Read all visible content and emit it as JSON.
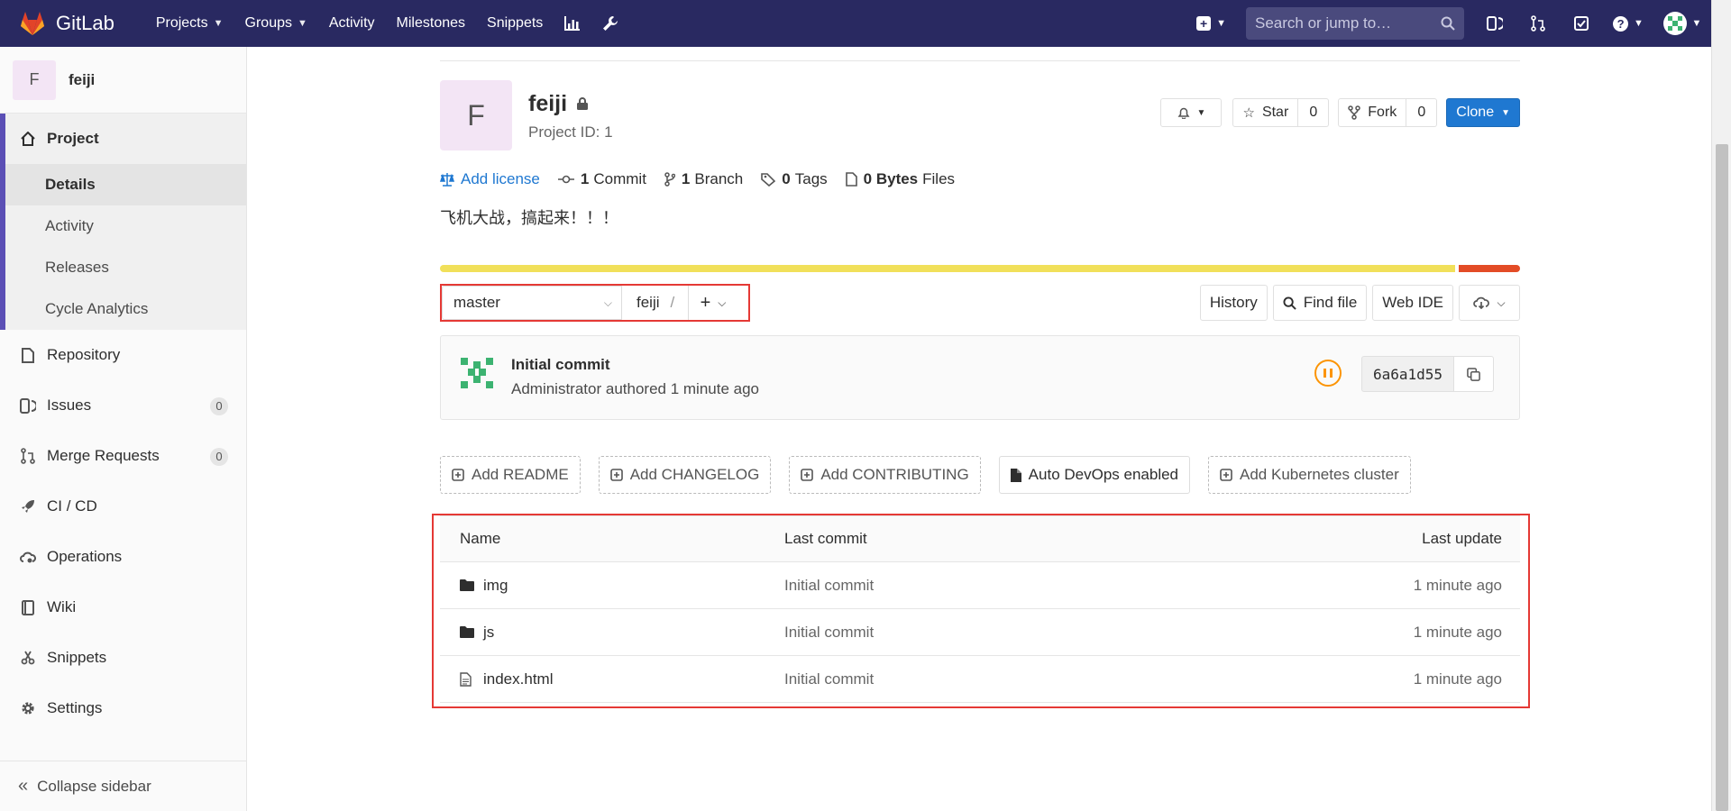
{
  "navbar": {
    "brand": "GitLab",
    "links": [
      {
        "label": "Projects",
        "caret": true
      },
      {
        "label": "Groups",
        "caret": true
      },
      {
        "label": "Activity",
        "caret": false
      },
      {
        "label": "Milestones",
        "caret": false
      },
      {
        "label": "Snippets",
        "caret": false
      }
    ],
    "icons": [
      "chart-icon",
      "wrench-icon"
    ],
    "search_placeholder": "Search or jump to…",
    "right_icons": [
      "issues-icon",
      "merge-request-icon",
      "todo-icon",
      "help-icon",
      "user-avatar"
    ],
    "bg_color": "#292961"
  },
  "sidebar": {
    "project_initial": "F",
    "project_name": "feiji",
    "section": {
      "label": "Project",
      "icon": "home-icon",
      "items": [
        "Details",
        "Activity",
        "Releases",
        "Cycle Analytics"
      ],
      "active": "Details"
    },
    "items": [
      {
        "label": "Repository",
        "icon": "doc-icon",
        "badge": null
      },
      {
        "label": "Issues",
        "icon": "issues-icon",
        "badge": "0"
      },
      {
        "label": "Merge Requests",
        "icon": "merge-request-icon",
        "badge": "0"
      },
      {
        "label": "CI / CD",
        "icon": "rocket-icon",
        "badge": null
      },
      {
        "label": "Operations",
        "icon": "cloud-gear-icon",
        "badge": null
      },
      {
        "label": "Wiki",
        "icon": "book-icon",
        "badge": null
      },
      {
        "label": "Snippets",
        "icon": "scissors-icon",
        "badge": null
      },
      {
        "label": "Settings",
        "icon": "gear-icon",
        "badge": null
      }
    ],
    "collapse_label": "Collapse sidebar"
  },
  "project": {
    "initial": "F",
    "name": "feiji",
    "id_label": "Project ID: 1",
    "star_label": "Star",
    "star_count": "0",
    "fork_label": "Fork",
    "fork_count": "0",
    "clone_label": "Clone",
    "stats": {
      "license": "Add license",
      "commits_num": "1",
      "commits_label": "Commit",
      "branches_num": "1",
      "branches_label": "Branch",
      "tags_num": "0",
      "tags_label": "Tags",
      "size_num": "0 Bytes",
      "size_label": "Files"
    },
    "description": "飞机大战，搞起来！！！",
    "languages": [
      {
        "color": "#f1e05a",
        "percent": 94
      },
      {
        "color": "#e34c26",
        "percent": 6
      }
    ]
  },
  "tree": {
    "branch": "master",
    "path": "feiji",
    "path_sep": "/",
    "actions": [
      "History",
      "Find file",
      "Web IDE"
    ]
  },
  "commit": {
    "title": "Initial commit",
    "meta": "Administrator authored 1 minute ago",
    "sha": "6a6a1d55",
    "pipeline_status": "paused",
    "pipeline_color": "#fc9403"
  },
  "quick_actions": [
    {
      "label": "Add README",
      "style": "dashed"
    },
    {
      "label": "Add CHANGELOG",
      "style": "dashed"
    },
    {
      "label": "Add CONTRIBUTING",
      "style": "dashed"
    },
    {
      "label": "Auto DevOps enabled",
      "style": "solid"
    },
    {
      "label": "Add Kubernetes cluster",
      "style": "dashed"
    }
  ],
  "files": {
    "headers": {
      "name": "Name",
      "commit": "Last commit",
      "update": "Last update"
    },
    "rows": [
      {
        "name": "img",
        "type": "folder",
        "commit": "Initial commit",
        "update": "1 minute ago"
      },
      {
        "name": "js",
        "type": "folder",
        "commit": "Initial commit",
        "update": "1 minute ago"
      },
      {
        "name": "index.html",
        "type": "file",
        "commit": "Initial commit",
        "update": "1 minute ago"
      }
    ]
  },
  "accent_colors": {
    "highlight_box": "#e53935",
    "link": "#1f78d1",
    "clone_button": "#1f78d1"
  }
}
